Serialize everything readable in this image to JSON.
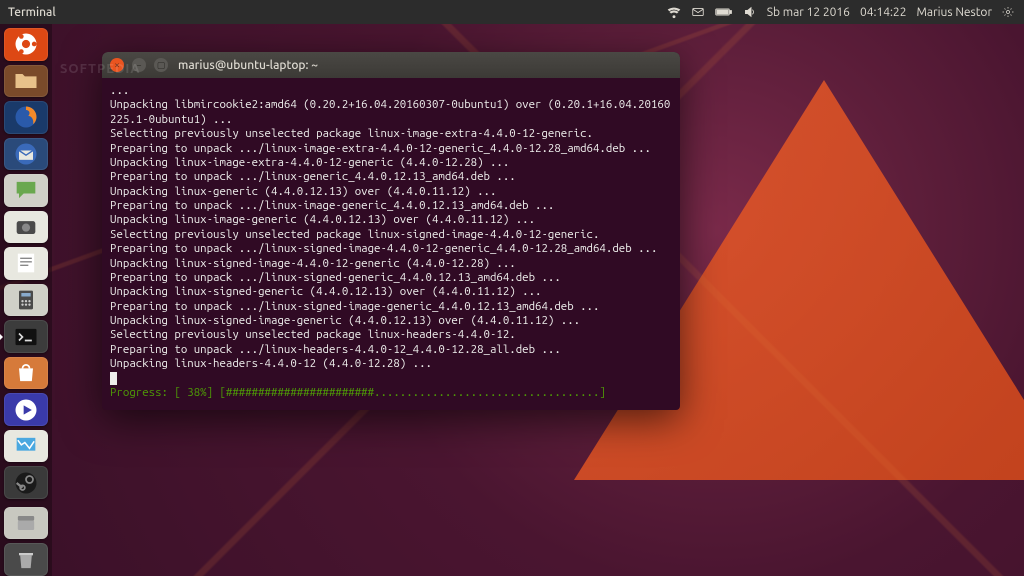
{
  "topbar": {
    "app_name": "Terminal",
    "date": "Sb mar 12 2016",
    "time": "04:14:22",
    "user": "Marius Nestor",
    "icons": [
      "network-icon",
      "mail-icon",
      "battery-icon",
      "volume-icon"
    ]
  },
  "watermark": "SOFTPEDIA",
  "launcher": {
    "items": [
      {
        "name": "dash-home",
        "bg": "#dd4814",
        "icon": "ubuntu"
      },
      {
        "name": "files",
        "bg": "#7a4a2a",
        "icon": "folder"
      },
      {
        "name": "firefox",
        "bg": "#1a3a6a",
        "icon": "firefox"
      },
      {
        "name": "thunderbird",
        "bg": "#2a4a7a",
        "icon": "mail"
      },
      {
        "name": "chat",
        "bg": "#d0d0c8",
        "icon": "chat"
      },
      {
        "name": "camera",
        "bg": "#e8e8e0",
        "icon": "camera"
      },
      {
        "name": "text-editor",
        "bg": "#e8e8e0",
        "icon": "note"
      },
      {
        "name": "calculator",
        "bg": "#d0d0c8",
        "icon": "calc"
      },
      {
        "name": "terminal",
        "bg": "#3c3c3c",
        "icon": "terminal",
        "active": true
      },
      {
        "name": "software",
        "bg": "#d67a3a",
        "icon": "bag"
      },
      {
        "name": "movie",
        "bg": "#3a3aaa",
        "icon": "play"
      },
      {
        "name": "monitor",
        "bg": "#e8e8e0",
        "icon": "monitor"
      },
      {
        "name": "steam",
        "bg": "#3a3a3a",
        "icon": "steam"
      }
    ],
    "bottom": [
      {
        "name": "archive",
        "bg": "#c8c8c0",
        "icon": "disk"
      },
      {
        "name": "trash",
        "bg": "#4a4a4a",
        "icon": "trash"
      }
    ]
  },
  "terminal": {
    "title": "marius@ubuntu-laptop: ~",
    "close_glyph": "×",
    "min_glyph": "−",
    "max_glyph": "▢",
    "lines": [
      "...",
      "Unpacking libmircookie2:amd64 (0.20.2+16.04.20160307-0ubuntu1) over (0.20.1+16.04.20160225.1-0ubuntu1) ...",
      "Selecting previously unselected package linux-image-extra-4.4.0-12-generic.",
      "Preparing to unpack .../linux-image-extra-4.4.0-12-generic_4.4.0-12.28_amd64.deb ...",
      "Unpacking linux-image-extra-4.4.0-12-generic (4.4.0-12.28) ...",
      "Preparing to unpack .../linux-generic_4.4.0.12.13_amd64.deb ...",
      "Unpacking linux-generic (4.4.0.12.13) over (4.4.0.11.12) ...",
      "Preparing to unpack .../linux-image-generic_4.4.0.12.13_amd64.deb ...",
      "Unpacking linux-image-generic (4.4.0.12.13) over (4.4.0.11.12) ...",
      "Selecting previously unselected package linux-signed-image-4.4.0-12-generic.",
      "Preparing to unpack .../linux-signed-image-4.4.0-12-generic_4.4.0-12.28_amd64.deb ...",
      "Unpacking linux-signed-image-4.4.0-12-generic (4.4.0-12.28) ...",
      "Preparing to unpack .../linux-signed-generic_4.4.0.12.13_amd64.deb ...",
      "Unpacking linux-signed-generic (4.4.0.12.13) over (4.4.0.11.12) ...",
      "Preparing to unpack .../linux-signed-image-generic_4.4.0.12.13_amd64.deb ...",
      "Unpacking linux-signed-image-generic (4.4.0.12.13) over (4.4.0.11.12) ...",
      "Selecting previously unselected package linux-headers-4.4.0-12.",
      "Preparing to unpack .../linux-headers-4.4.0-12_4.4.0-12.28_all.deb ...",
      "Unpacking linux-headers-4.4.0-12 (4.4.0-12.28) ..."
    ],
    "progress": {
      "label": "Progress:",
      "percent_text": "[ 38%]",
      "bar": "[#######################...................................]"
    }
  }
}
